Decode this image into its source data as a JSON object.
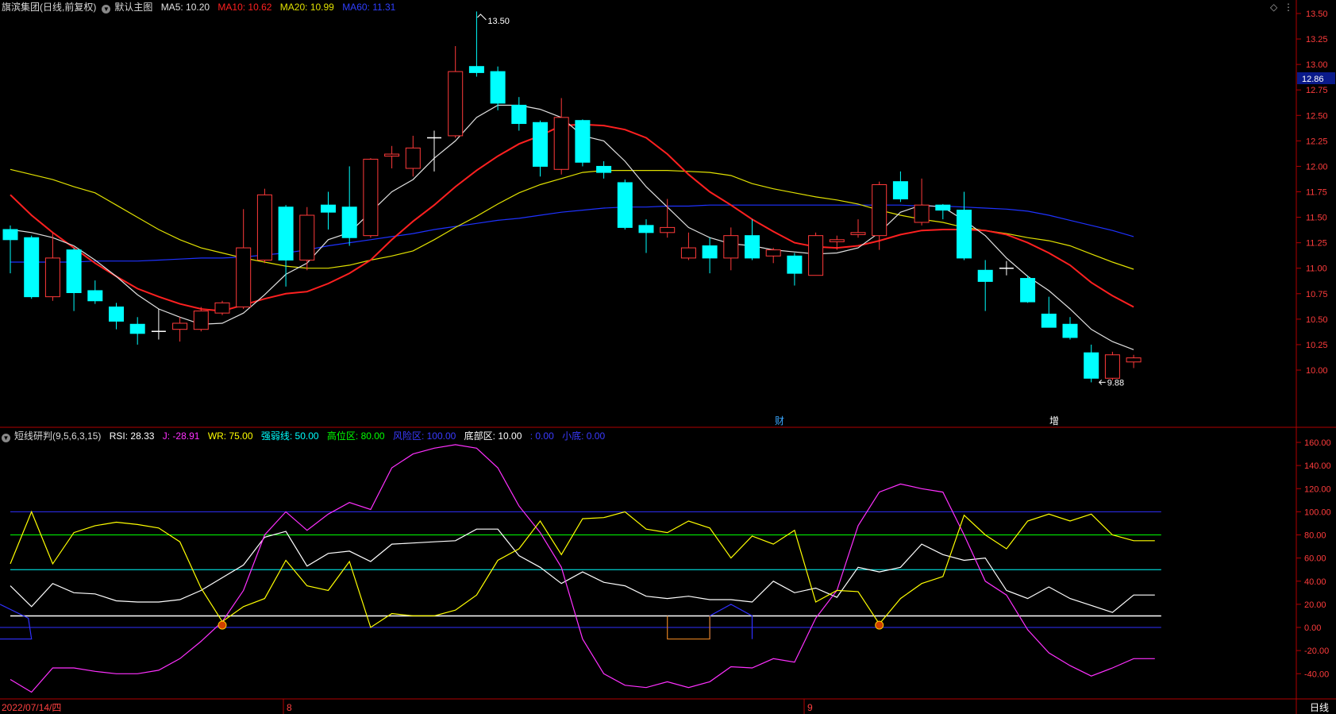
{
  "colors": {
    "up": "#ff3a3a",
    "down": "#00ffff",
    "ma5": "#e0e0e0",
    "ma10": "#ff2020",
    "ma20": "#e0e000",
    "ma60": "#1e32ff",
    "frame": "#b00000",
    "tick": "#ff3c3c",
    "rsi": "#ffffff",
    "j": "#ff30ff",
    "wr": "#ffff00",
    "strong": "#00ffff",
    "high": "#00ff00",
    "risk": "#2f2fff",
    "bottom": "#ffffff"
  },
  "header": {
    "stock": "旗滨集团(日线,前复权)",
    "indicator": "默认主图",
    "ma5": "MA5: 10.20",
    "ma10": "MA10: 10.62",
    "ma20": "MA20: 10.99",
    "ma60": "MA60: 11.31"
  },
  "sub_header": {
    "name": "短线研判(9,5,6,3,15)",
    "rsi": "RSI: 28.33",
    "j": "J: -28.91",
    "wr": "WR: 75.00",
    "strong": "强弱线: 50.00",
    "high": "高位区: 80.00",
    "risk": "风险区: 100.00",
    "bottom": "底部区: 10.00",
    "blank1": ": 0.00",
    "small": "小底: 0.00"
  },
  "price_box": "12.86",
  "footer": {
    "date": "2022/07/14/四",
    "month8": "8",
    "month9": "9",
    "period": "日线"
  },
  "chart_data": [
    {
      "type": "candlestick",
      "ylim": [
        9.8,
        13.6
      ],
      "yticks": [
        "10.00",
        "10.25",
        "10.50",
        "10.75",
        "11.00",
        "11.25",
        "11.50",
        "11.75",
        "12.00",
        "12.25",
        "12.50",
        "12.75",
        "13.00",
        "13.25",
        "13.50"
      ],
      "annotations": {
        "high": "13.50",
        "low": "9.88",
        "cai": "财",
        "zeng": "增"
      },
      "candles": [
        [
          11.38,
          11.28,
          11.42,
          10.95
        ],
        [
          11.3,
          10.72,
          11.32,
          10.7
        ],
        [
          10.72,
          11.1,
          11.35,
          10.68
        ],
        [
          11.18,
          10.76,
          11.2,
          10.58
        ],
        [
          10.78,
          10.68,
          10.88,
          10.65
        ],
        [
          10.62,
          10.48,
          10.66,
          10.4
        ],
        [
          10.45,
          10.36,
          10.52,
          10.25
        ],
        [
          10.38,
          10.38,
          10.6,
          10.3
        ],
        [
          10.4,
          10.46,
          10.52,
          10.28
        ],
        [
          10.4,
          10.58,
          10.62,
          10.38
        ],
        [
          10.56,
          10.66,
          10.68,
          10.54
        ],
        [
          10.62,
          11.2,
          11.58,
          10.6
        ],
        [
          11.08,
          11.72,
          11.78,
          11.05
        ],
        [
          11.6,
          11.08,
          11.62,
          10.82
        ],
        [
          11.08,
          11.52,
          11.6,
          10.98
        ],
        [
          11.62,
          11.55,
          11.75,
          11.38
        ],
        [
          11.6,
          11.3,
          12.0,
          11.22
        ],
        [
          11.32,
          12.07,
          12.08,
          11.3
        ],
        [
          12.1,
          12.12,
          12.2,
          11.98
        ],
        [
          11.98,
          12.18,
          12.3,
          11.9
        ],
        [
          12.28,
          12.28,
          12.35,
          11.95
        ],
        [
          12.3,
          12.93,
          13.18,
          12.28
        ],
        [
          12.98,
          12.92,
          13.52,
          12.88
        ],
        [
          12.93,
          12.62,
          12.98,
          12.55
        ],
        [
          12.6,
          12.42,
          12.68,
          12.35
        ],
        [
          12.43,
          12.0,
          12.45,
          11.9
        ],
        [
          11.97,
          12.48,
          12.67,
          11.92
        ],
        [
          12.45,
          12.04,
          12.46,
          12.0
        ],
        [
          12.0,
          11.94,
          12.05,
          11.88
        ],
        [
          11.84,
          11.4,
          11.87,
          11.38
        ],
        [
          11.42,
          11.35,
          11.48,
          11.15
        ],
        [
          11.35,
          11.4,
          11.68,
          11.3
        ],
        [
          11.1,
          11.2,
          11.35,
          11.08
        ],
        [
          11.22,
          11.1,
          11.3,
          10.95
        ],
        [
          11.1,
          11.32,
          11.4,
          10.98
        ],
        [
          11.32,
          11.1,
          11.48,
          11.08
        ],
        [
          11.12,
          11.18,
          11.2,
          11.05
        ],
        [
          11.12,
          10.95,
          11.15,
          10.83
        ],
        [
          10.93,
          11.32,
          11.35,
          10.93
        ],
        [
          11.26,
          11.28,
          11.32,
          11.18
        ],
        [
          11.33,
          11.35,
          11.48,
          11.3
        ],
        [
          11.32,
          11.82,
          11.85,
          11.18
        ],
        [
          11.85,
          11.68,
          11.95,
          11.65
        ],
        [
          11.45,
          11.62,
          11.88,
          11.42
        ],
        [
          11.62,
          11.57,
          11.63,
          11.48
        ],
        [
          11.57,
          11.1,
          11.75,
          11.08
        ],
        [
          10.98,
          10.87,
          11.08,
          10.58
        ],
        [
          11.0,
          11.0,
          11.07,
          10.93
        ],
        [
          10.9,
          10.67,
          10.93,
          10.66
        ],
        [
          10.55,
          10.42,
          10.72,
          10.42
        ],
        [
          10.45,
          10.32,
          10.52,
          10.3
        ],
        [
          10.17,
          9.92,
          10.25,
          9.88
        ],
        [
          9.92,
          10.15,
          10.18,
          9.9
        ],
        [
          10.08,
          10.12,
          10.15,
          10.02
        ]
      ],
      "ma5": [
        11.38,
        11.35,
        11.3,
        11.22,
        11.08,
        10.92,
        10.74,
        10.6,
        10.52,
        10.45,
        10.46,
        10.56,
        10.74,
        10.94,
        11.05,
        11.28,
        11.35,
        11.55,
        11.75,
        11.87,
        12.08,
        12.25,
        12.48,
        12.6,
        12.6,
        12.56,
        12.48,
        12.3,
        12.25,
        12.05,
        11.8,
        11.6,
        11.4,
        11.3,
        11.24,
        11.22,
        11.18,
        11.16,
        11.14,
        11.15,
        11.2,
        11.35,
        11.55,
        11.62,
        11.6,
        11.47,
        11.32,
        11.1,
        10.92,
        10.78,
        10.6,
        10.4,
        10.28,
        10.2
      ],
      "ma10": [
        11.72,
        11.52,
        11.35,
        11.2,
        11.05,
        10.92,
        10.8,
        10.72,
        10.65,
        10.6,
        10.58,
        10.64,
        10.7,
        10.75,
        10.77,
        10.85,
        10.95,
        11.08,
        11.28,
        11.46,
        11.62,
        11.8,
        11.96,
        12.1,
        12.22,
        12.3,
        12.4,
        12.41,
        12.4,
        12.36,
        12.28,
        12.12,
        11.92,
        11.75,
        11.62,
        11.48,
        11.36,
        11.25,
        11.21,
        11.2,
        11.22,
        11.27,
        11.33,
        11.37,
        11.38,
        11.38,
        11.37,
        11.33,
        11.25,
        11.15,
        11.03,
        10.86,
        10.73,
        10.62
      ],
      "ma20": [
        11.97,
        11.92,
        11.87,
        11.8,
        11.74,
        11.62,
        11.5,
        11.38,
        11.28,
        11.2,
        11.15,
        11.1,
        11.06,
        11.02,
        11.0,
        11.0,
        11.03,
        11.08,
        11.12,
        11.17,
        11.28,
        11.4,
        11.51,
        11.63,
        11.74,
        11.82,
        11.88,
        11.94,
        11.96,
        11.96,
        11.96,
        11.96,
        11.95,
        11.94,
        11.91,
        11.83,
        11.78,
        11.74,
        11.7,
        11.67,
        11.63,
        11.57,
        11.52,
        11.48,
        11.45,
        11.4,
        11.37,
        11.34,
        11.3,
        11.27,
        11.22,
        11.14,
        11.06,
        10.99
      ],
      "ma60": [
        11.06,
        11.06,
        11.06,
        11.06,
        11.07,
        11.07,
        11.07,
        11.08,
        11.09,
        11.1,
        11.1,
        11.11,
        11.13,
        11.15,
        11.18,
        11.22,
        11.25,
        11.28,
        11.31,
        11.34,
        11.38,
        11.41,
        11.44,
        11.47,
        11.49,
        11.52,
        11.55,
        11.57,
        11.59,
        11.6,
        11.6,
        11.61,
        11.61,
        11.62,
        11.62,
        11.62,
        11.62,
        11.62,
        11.62,
        11.62,
        11.62,
        11.62,
        11.62,
        11.61,
        11.61,
        11.6,
        11.59,
        11.58,
        11.56,
        11.52,
        11.47,
        11.42,
        11.37,
        11.31
      ]
    },
    {
      "type": "line",
      "ylim": [
        -50,
        165
      ],
      "yticks": [
        "-40.00",
        "-20.00",
        "0.00",
        "20.00",
        "40.00",
        "60.00",
        "80.00",
        "100.00",
        "120.00",
        "140.00",
        "160.00"
      ],
      "reference_lines": {
        "risk": 100,
        "high": 80,
        "strong": 50,
        "bottom": 10,
        "zero": 0
      },
      "series": [
        {
          "name": "RSI",
          "values": [
            36,
            18,
            38,
            30,
            29,
            23,
            22,
            22,
            24,
            32,
            43,
            54,
            78,
            83,
            53,
            64,
            66,
            57,
            72,
            73,
            74,
            75,
            85,
            85,
            62,
            52,
            38,
            48,
            39,
            36,
            27,
            25,
            27,
            24,
            24,
            22,
            40,
            30,
            34,
            26,
            52,
            48,
            52,
            72,
            63,
            58,
            60,
            32,
            25,
            35,
            25,
            19,
            13,
            28,
            28
          ]
        },
        {
          "name": "J",
          "values": [
            -45,
            -56,
            -35,
            -35,
            -38,
            -40,
            -40,
            -37,
            -27,
            -12,
            5,
            32,
            80,
            100,
            84,
            98,
            108,
            102,
            138,
            150,
            155,
            158,
            155,
            138,
            105,
            82,
            52,
            -10,
            -40,
            -50,
            -52,
            -47,
            -52,
            -47,
            -34,
            -35,
            -27,
            -30,
            8,
            32,
            88,
            117,
            124,
            120,
            117,
            80,
            40,
            28,
            -2,
            -22,
            -33,
            -42,
            -35,
            -27,
            -27
          ]
        },
        {
          "name": "WR",
          "values": [
            55,
            100,
            55,
            82,
            88,
            91,
            89,
            86,
            74,
            34,
            5,
            18,
            25,
            58,
            36,
            32,
            57,
            0,
            12,
            10,
            10,
            15,
            28,
            58,
            68,
            92,
            63,
            94,
            95,
            100,
            85,
            82,
            92,
            86,
            60,
            79,
            72,
            84,
            22,
            32,
            31,
            3,
            25,
            38,
            44,
            97,
            80,
            68,
            92,
            98,
            92,
            98,
            80,
            75,
            75
          ]
        }
      ],
      "bottom_marks": {
        "orange_rect": [
          31,
          33
        ],
        "blue_humps": [
          [
            0,
            1
          ],
          [
            33,
            35
          ]
        ],
        "signals": [
          10,
          41
        ]
      }
    }
  ]
}
